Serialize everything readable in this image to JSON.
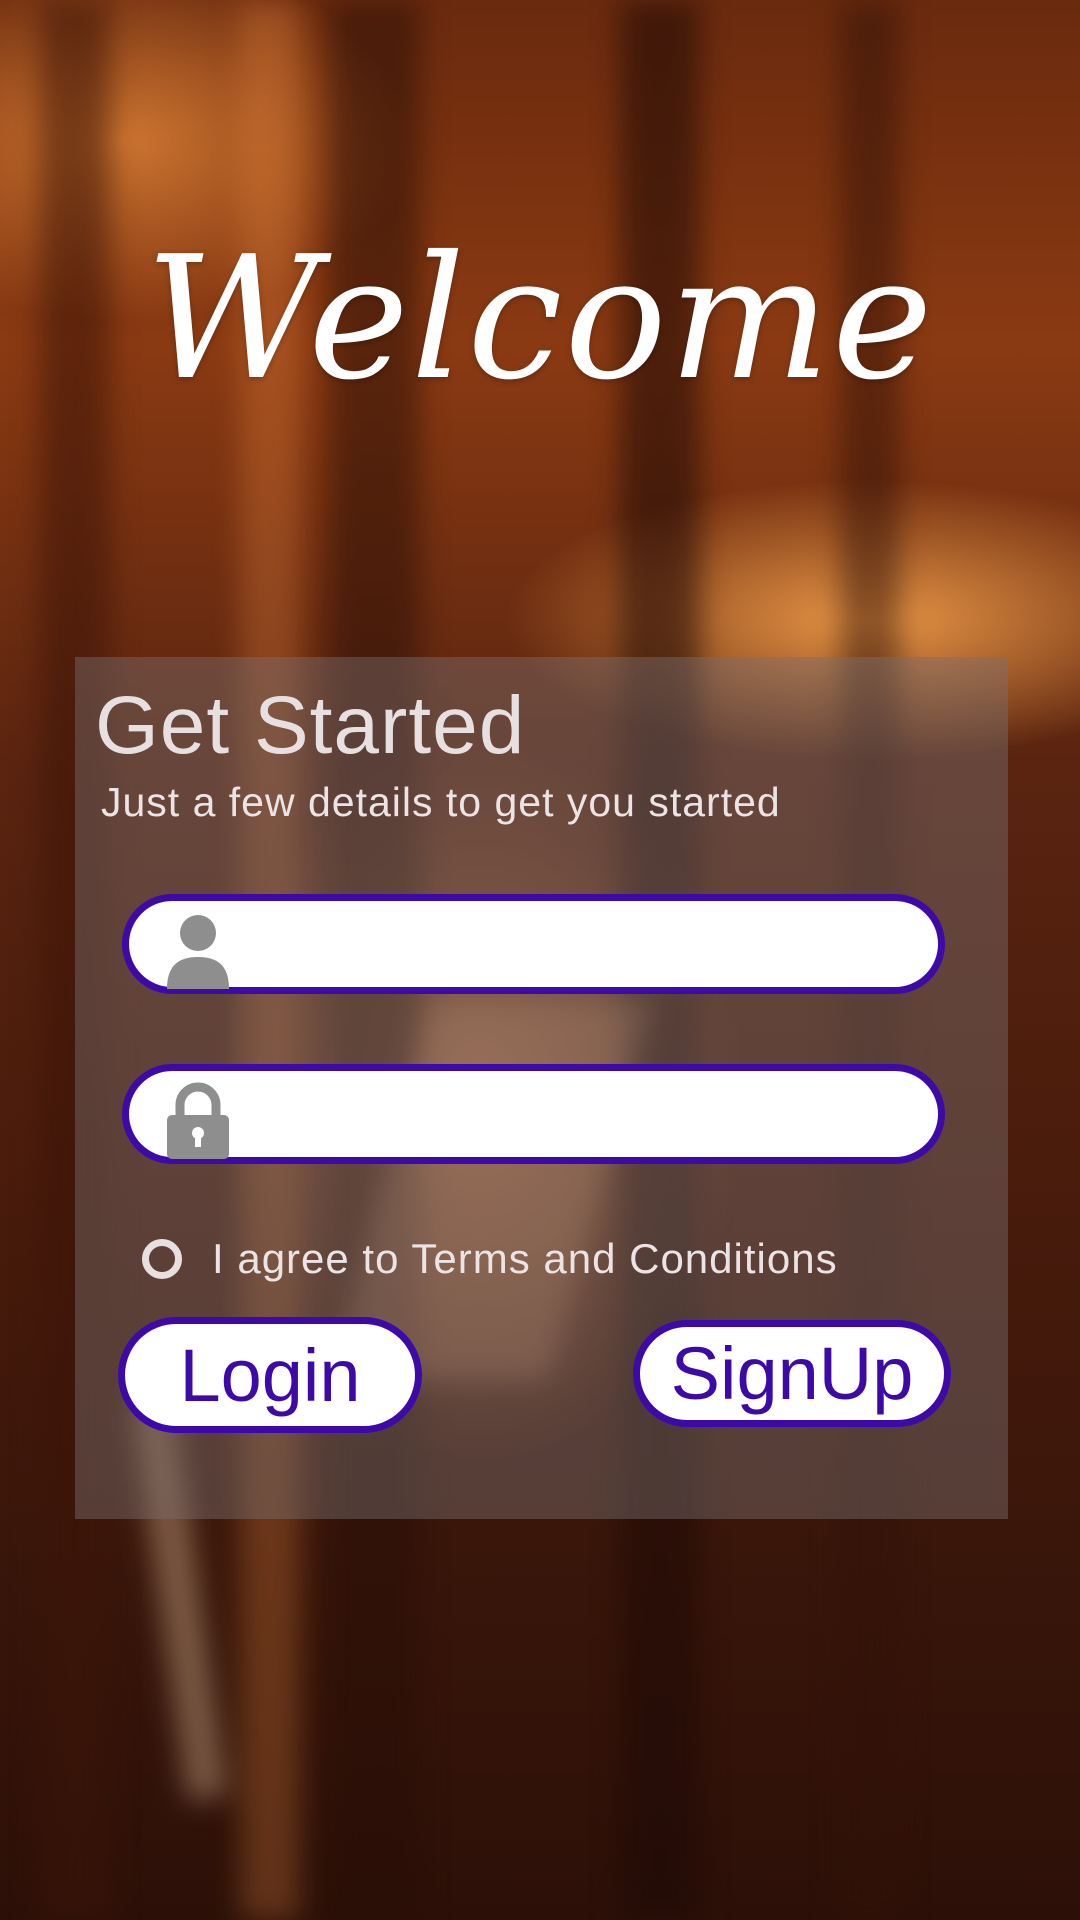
{
  "header": {
    "welcome": "Welcome"
  },
  "form": {
    "title": "Get Started",
    "subtitle": "Just a few details to get you started",
    "username": {
      "value": "",
      "icon": "person-icon"
    },
    "password": {
      "value": "",
      "icon": "lock-icon"
    },
    "agree_label": "I agree to Terms and Conditions",
    "agree_checked": false
  },
  "buttons": {
    "login": "Login",
    "signup": "SignUp"
  },
  "colors": {
    "accent": "#3d0aa8",
    "field_bg": "#ffffff",
    "panel": "rgba(120,110,110,0.45)",
    "text_light": "#ece4e4"
  }
}
